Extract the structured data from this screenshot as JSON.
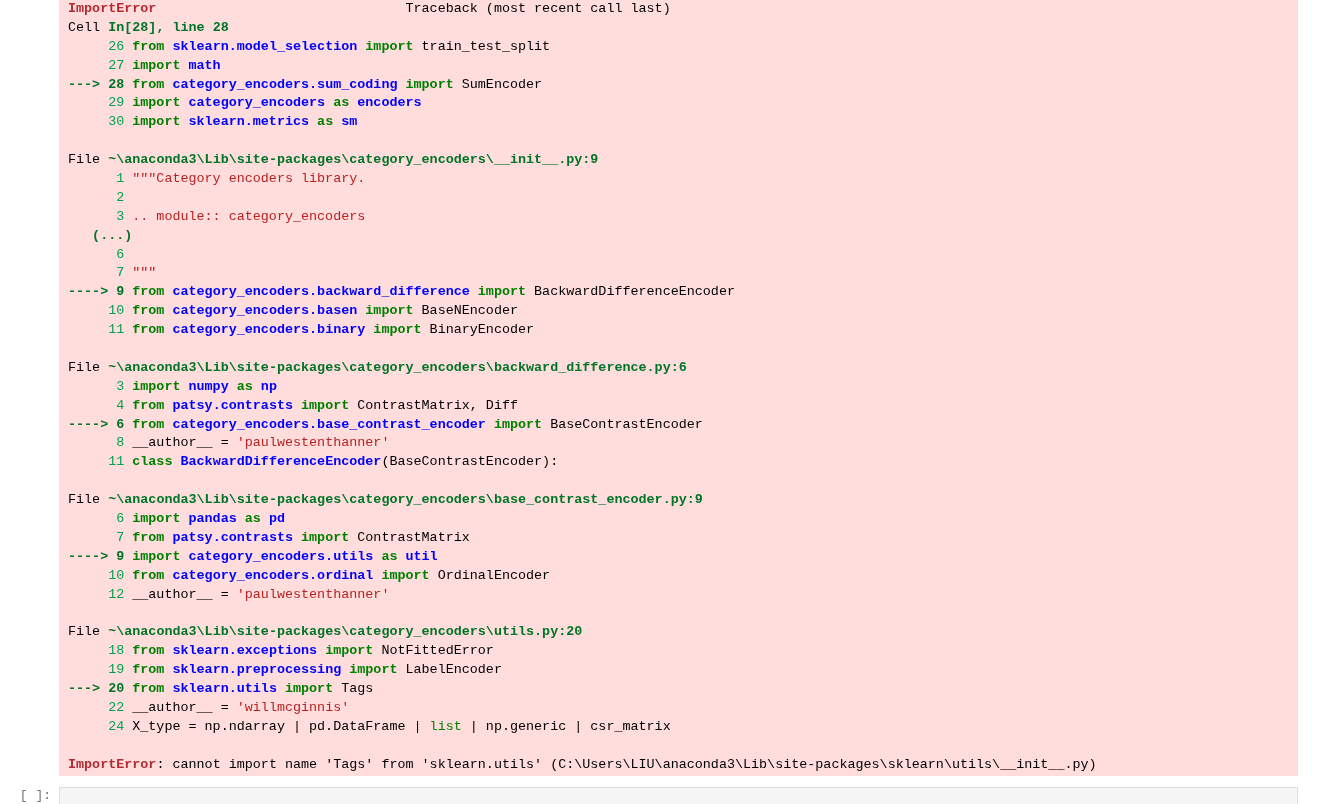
{
  "traceback": {
    "header": {
      "exception": "ImportError",
      "label": "Traceback (most recent call last)"
    },
    "frames": [
      {
        "prefix": "Cell",
        "location": "In[28], line 28",
        "lines": [
          {
            "kind": "code",
            "number": "26",
            "tokens": [
              {
                "kind": "keyword",
                "text": "from "
              },
              {
                "kind": "name",
                "text": "sklearn.model_selection "
              },
              {
                "kind": "keyword",
                "text": "import "
              },
              {
                "kind": "plain",
                "text": "train_test_split"
              }
            ]
          },
          {
            "kind": "code",
            "number": "27",
            "tokens": [
              {
                "kind": "keyword",
                "text": "import "
              },
              {
                "kind": "name",
                "text": "math"
              }
            ]
          },
          {
            "kind": "code",
            "marker": "--->",
            "number": "28",
            "tokens": [
              {
                "kind": "keyword",
                "text": "from "
              },
              {
                "kind": "name",
                "text": "category_encoders.sum_coding "
              },
              {
                "kind": "keyword",
                "text": "import "
              },
              {
                "kind": "plain",
                "text": "SumEncoder"
              }
            ]
          },
          {
            "kind": "code",
            "number": "29",
            "tokens": [
              {
                "kind": "keyword",
                "text": "import "
              },
              {
                "kind": "name",
                "text": "category_encoders "
              },
              {
                "kind": "keyword",
                "text": "as "
              },
              {
                "kind": "name",
                "text": "encoders"
              }
            ]
          },
          {
            "kind": "code",
            "number": "30",
            "tokens": [
              {
                "kind": "keyword",
                "text": "import "
              },
              {
                "kind": "name",
                "text": "sklearn.metrics "
              },
              {
                "kind": "keyword",
                "text": "as "
              },
              {
                "kind": "name",
                "text": "sm"
              }
            ]
          }
        ]
      },
      {
        "prefix": "File",
        "location": "~\\anaconda3\\Lib\\site-packages\\category_encoders\\__init__.py:9",
        "lines": [
          {
            "kind": "code",
            "number": "1",
            "tokens": [
              {
                "kind": "string",
                "text": "\"\"\"Category encoders library."
              }
            ]
          },
          {
            "kind": "code",
            "number": "2"
          },
          {
            "kind": "code",
            "number": "3",
            "tokens": [
              {
                "kind": "string",
                "text": ".. module:: category_encoders"
              }
            ]
          },
          {
            "kind": "elision",
            "text": "(...)"
          },
          {
            "kind": "code",
            "number": "6"
          },
          {
            "kind": "code",
            "number": "7",
            "tokens": [
              {
                "kind": "string",
                "text": "\"\"\""
              }
            ]
          },
          {
            "kind": "code",
            "marker": "---->",
            "number": "9",
            "tokens": [
              {
                "kind": "keyword",
                "text": "from "
              },
              {
                "kind": "name",
                "text": "category_encoders.backward_difference "
              },
              {
                "kind": "keyword",
                "text": "import "
              },
              {
                "kind": "plain",
                "text": "BackwardDifferenceEncoder"
              }
            ]
          },
          {
            "kind": "code",
            "number": "10",
            "tokens": [
              {
                "kind": "keyword",
                "text": "from "
              },
              {
                "kind": "name",
                "text": "category_encoders.basen "
              },
              {
                "kind": "keyword",
                "text": "import "
              },
              {
                "kind": "plain",
                "text": "BaseNEncoder"
              }
            ]
          },
          {
            "kind": "code",
            "number": "11",
            "tokens": [
              {
                "kind": "keyword",
                "text": "from "
              },
              {
                "kind": "name",
                "text": "category_encoders.binary "
              },
              {
                "kind": "keyword",
                "text": "import "
              },
              {
                "kind": "plain",
                "text": "BinaryEncoder"
              }
            ]
          }
        ]
      },
      {
        "prefix": "File",
        "location": "~\\anaconda3\\Lib\\site-packages\\category_encoders\\backward_difference.py:6",
        "lines": [
          {
            "kind": "code",
            "number": "3",
            "tokens": [
              {
                "kind": "keyword",
                "text": "import "
              },
              {
                "kind": "name",
                "text": "numpy "
              },
              {
                "kind": "keyword",
                "text": "as "
              },
              {
                "kind": "name",
                "text": "np"
              }
            ]
          },
          {
            "kind": "code",
            "number": "4",
            "tokens": [
              {
                "kind": "keyword",
                "text": "from "
              },
              {
                "kind": "name",
                "text": "patsy.contrasts "
              },
              {
                "kind": "keyword",
                "text": "import "
              },
              {
                "kind": "plain",
                "text": "ContrastMatrix, Diff"
              }
            ]
          },
          {
            "kind": "code",
            "marker": "---->",
            "number": "6",
            "tokens": [
              {
                "kind": "keyword",
                "text": "from "
              },
              {
                "kind": "name",
                "text": "category_encoders.base_contrast_encoder "
              },
              {
                "kind": "keyword",
                "text": "import "
              },
              {
                "kind": "plain",
                "text": "BaseContrastEncoder"
              }
            ]
          },
          {
            "kind": "code",
            "number": "8",
            "tokens": [
              {
                "kind": "plain",
                "text": "__author__ = "
              },
              {
                "kind": "string",
                "text": "'paulwestenthanner'"
              }
            ]
          },
          {
            "kind": "code",
            "number": "11",
            "tokens": [
              {
                "kind": "keyword",
                "text": "class "
              },
              {
                "kind": "name",
                "text": "BackwardDifferenceEncoder"
              },
              {
                "kind": "plain",
                "text": "(BaseContrastEncoder):"
              }
            ]
          }
        ]
      },
      {
        "prefix": "File",
        "location": "~\\anaconda3\\Lib\\site-packages\\category_encoders\\base_contrast_encoder.py:9",
        "lines": [
          {
            "kind": "code",
            "number": "6",
            "tokens": [
              {
                "kind": "keyword",
                "text": "import "
              },
              {
                "kind": "name",
                "text": "pandas "
              },
              {
                "kind": "keyword",
                "text": "as "
              },
              {
                "kind": "name",
                "text": "pd"
              }
            ]
          },
          {
            "kind": "code",
            "number": "7",
            "tokens": [
              {
                "kind": "keyword",
                "text": "from "
              },
              {
                "kind": "name",
                "text": "patsy.contrasts "
              },
              {
                "kind": "keyword",
                "text": "import "
              },
              {
                "kind": "plain",
                "text": "ContrastMatrix"
              }
            ]
          },
          {
            "kind": "code",
            "marker": "---->",
            "number": "9",
            "tokens": [
              {
                "kind": "keyword",
                "text": "import "
              },
              {
                "kind": "name",
                "text": "category_encoders.utils "
              },
              {
                "kind": "keyword",
                "text": "as "
              },
              {
                "kind": "name",
                "text": "util"
              }
            ]
          },
          {
            "kind": "code",
            "number": "10",
            "tokens": [
              {
                "kind": "keyword",
                "text": "from "
              },
              {
                "kind": "name",
                "text": "category_encoders.ordinal "
              },
              {
                "kind": "keyword",
                "text": "import "
              },
              {
                "kind": "plain",
                "text": "OrdinalEncoder"
              }
            ]
          },
          {
            "kind": "code",
            "number": "12",
            "tokens": [
              {
                "kind": "plain",
                "text": "__author__ = "
              },
              {
                "kind": "string",
                "text": "'paulwestenthanner'"
              }
            ]
          }
        ]
      },
      {
        "prefix": "File",
        "location": "~\\anaconda3\\Lib\\site-packages\\category_encoders\\utils.py:20",
        "lines": [
          {
            "kind": "code",
            "number": "18",
            "tokens": [
              {
                "kind": "keyword",
                "text": "from "
              },
              {
                "kind": "name",
                "text": "sklearn.exceptions "
              },
              {
                "kind": "keyword",
                "text": "import "
              },
              {
                "kind": "plain",
                "text": "NotFittedError"
              }
            ]
          },
          {
            "kind": "code",
            "number": "19",
            "tokens": [
              {
                "kind": "keyword",
                "text": "from "
              },
              {
                "kind": "name",
                "text": "sklearn.preprocessing "
              },
              {
                "kind": "keyword",
                "text": "import "
              },
              {
                "kind": "plain",
                "text": "LabelEncoder"
              }
            ]
          },
          {
            "kind": "code",
            "marker": "--->",
            "number": "20",
            "tokens": [
              {
                "kind": "keyword",
                "text": "from "
              },
              {
                "kind": "name",
                "text": "sklearn.utils "
              },
              {
                "kind": "keyword",
                "text": "import "
              },
              {
                "kind": "plain",
                "text": "Tags"
              }
            ]
          },
          {
            "kind": "code",
            "number": "22",
            "tokens": [
              {
                "kind": "plain",
                "text": "__author__ = "
              },
              {
                "kind": "string",
                "text": "'willmcginnis'"
              }
            ]
          },
          {
            "kind": "code",
            "number": "24",
            "tokens": [
              {
                "kind": "plain",
                "text": "X_type = np.ndarray | pd.DataFrame | "
              },
              {
                "kind": "builtin",
                "text": "list"
              },
              {
                "kind": "plain",
                "text": " | np.generic | csr_matrix"
              }
            ]
          }
        ]
      }
    ],
    "error": {
      "exception": "ImportError",
      "message": ": cannot import name 'Tags' from 'sklearn.utils' (C:\\Users\\LIU\\anaconda3\\Lib\\site-packages\\sklearn\\utils\\__init__.py)"
    }
  },
  "next_cell": {
    "prompt": "[ ]:"
  }
}
